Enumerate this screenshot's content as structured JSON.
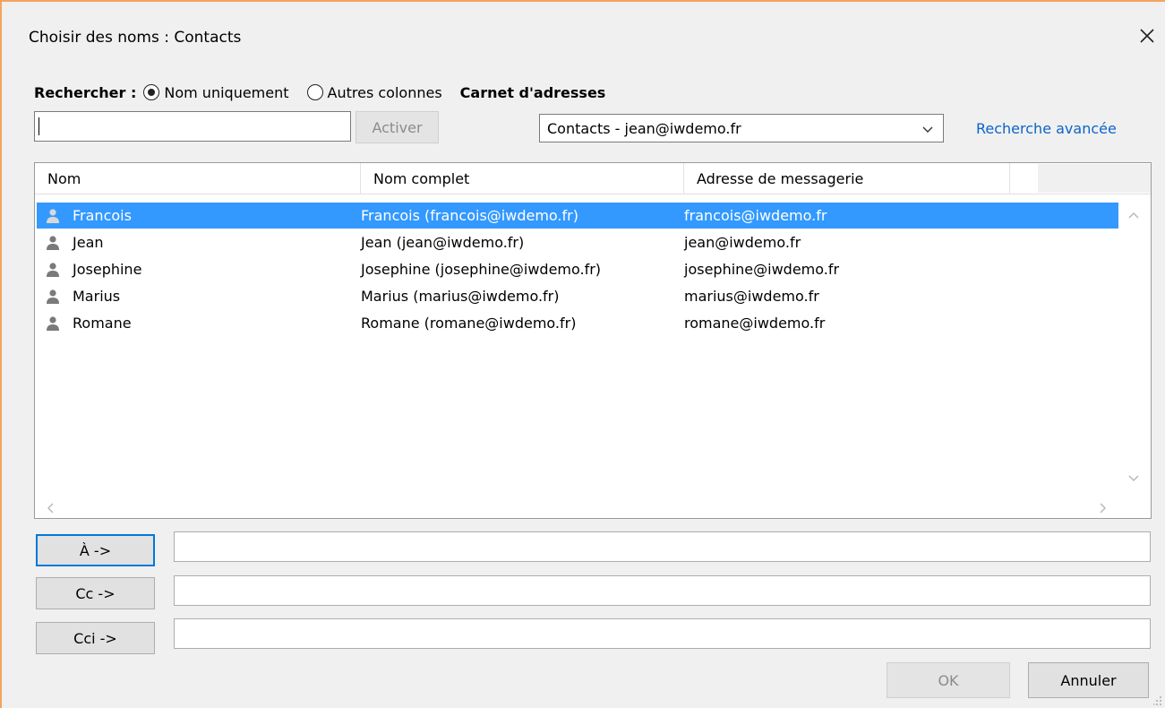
{
  "dialog": {
    "title": "Choisir des noms : Contacts"
  },
  "search": {
    "label": "Rechercher :",
    "option_name_only": "Nom uniquement",
    "option_other_columns": "Autres colonnes",
    "selected_option": "Nom uniquement",
    "input_value": "",
    "go_button": "Activer"
  },
  "address_book": {
    "label": "Carnet d'adresses",
    "selected": "Contacts - jean@iwdemo.fr",
    "advanced_link": "Recherche avancée"
  },
  "list": {
    "columns": [
      "Nom",
      "Nom complet",
      "Adresse de messagerie"
    ],
    "rows": [
      {
        "icon": "contact-person-icon",
        "name": "Francois",
        "full_name": "Francois (francois@iwdemo.fr)",
        "email": "francois@iwdemo.fr",
        "selected": true
      },
      {
        "icon": "contact-person-icon",
        "name": "Jean",
        "full_name": "Jean (jean@iwdemo.fr)",
        "email": "jean@iwdemo.fr",
        "selected": false
      },
      {
        "icon": "contact-person-icon",
        "name": "Josephine",
        "full_name": "Josephine (josephine@iwdemo.fr)",
        "email": "josephine@iwdemo.fr",
        "selected": false
      },
      {
        "icon": "contact-person-icon",
        "name": "Marius",
        "full_name": "Marius (marius@iwdemo.fr)",
        "email": "marius@iwdemo.fr",
        "selected": false
      },
      {
        "icon": "contact-person-icon",
        "name": "Romane",
        "full_name": "Romane (romane@iwdemo.fr)",
        "email": "romane@iwdemo.fr",
        "selected": false
      }
    ]
  },
  "recipients": {
    "to_button": "À ->",
    "cc_button": "Cc ->",
    "bcc_button": "Cci ->",
    "to_value": "",
    "cc_value": "",
    "bcc_value": ""
  },
  "footer": {
    "ok_button": "OK",
    "cancel_button": "Annuler"
  },
  "colors": {
    "selection": "#3399ff",
    "link": "#0b64c9",
    "focus": "#0078d7",
    "window_frame": "#f4a460"
  }
}
